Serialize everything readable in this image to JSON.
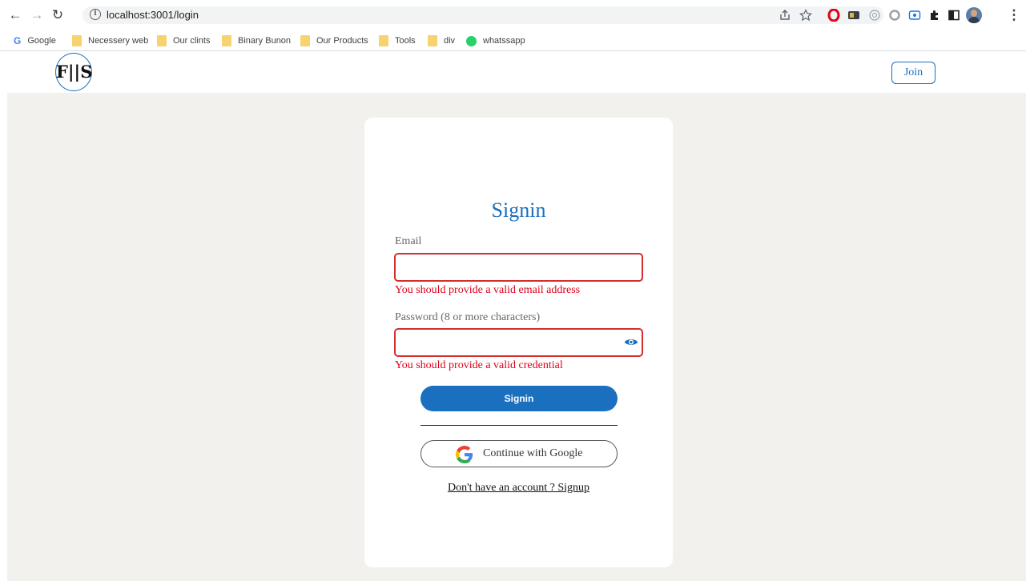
{
  "browser": {
    "url": "localhost:3001/login",
    "bookmarks": [
      "Google",
      "Necessery web",
      "Our clints",
      "Binary Bunon",
      "Our Products",
      "Tools",
      "div",
      "whatssapp"
    ]
  },
  "header": {
    "logo_text": "F||S",
    "join_label": "Join"
  },
  "form": {
    "title": "Signin",
    "email_label": "Email",
    "email_value": "",
    "email_error": "You should provide a valid email address",
    "password_label": "Password (8 or more characters)",
    "password_value": "",
    "password_error": "You should provide a valid credential",
    "signin_label": "Signin",
    "google_label": "Continue with Google",
    "signup_link": "Don't have an account ? Signup"
  },
  "colors": {
    "primary": "#1a6fbf",
    "error": "#e0001b",
    "page_bg": "#f2f1ee"
  }
}
